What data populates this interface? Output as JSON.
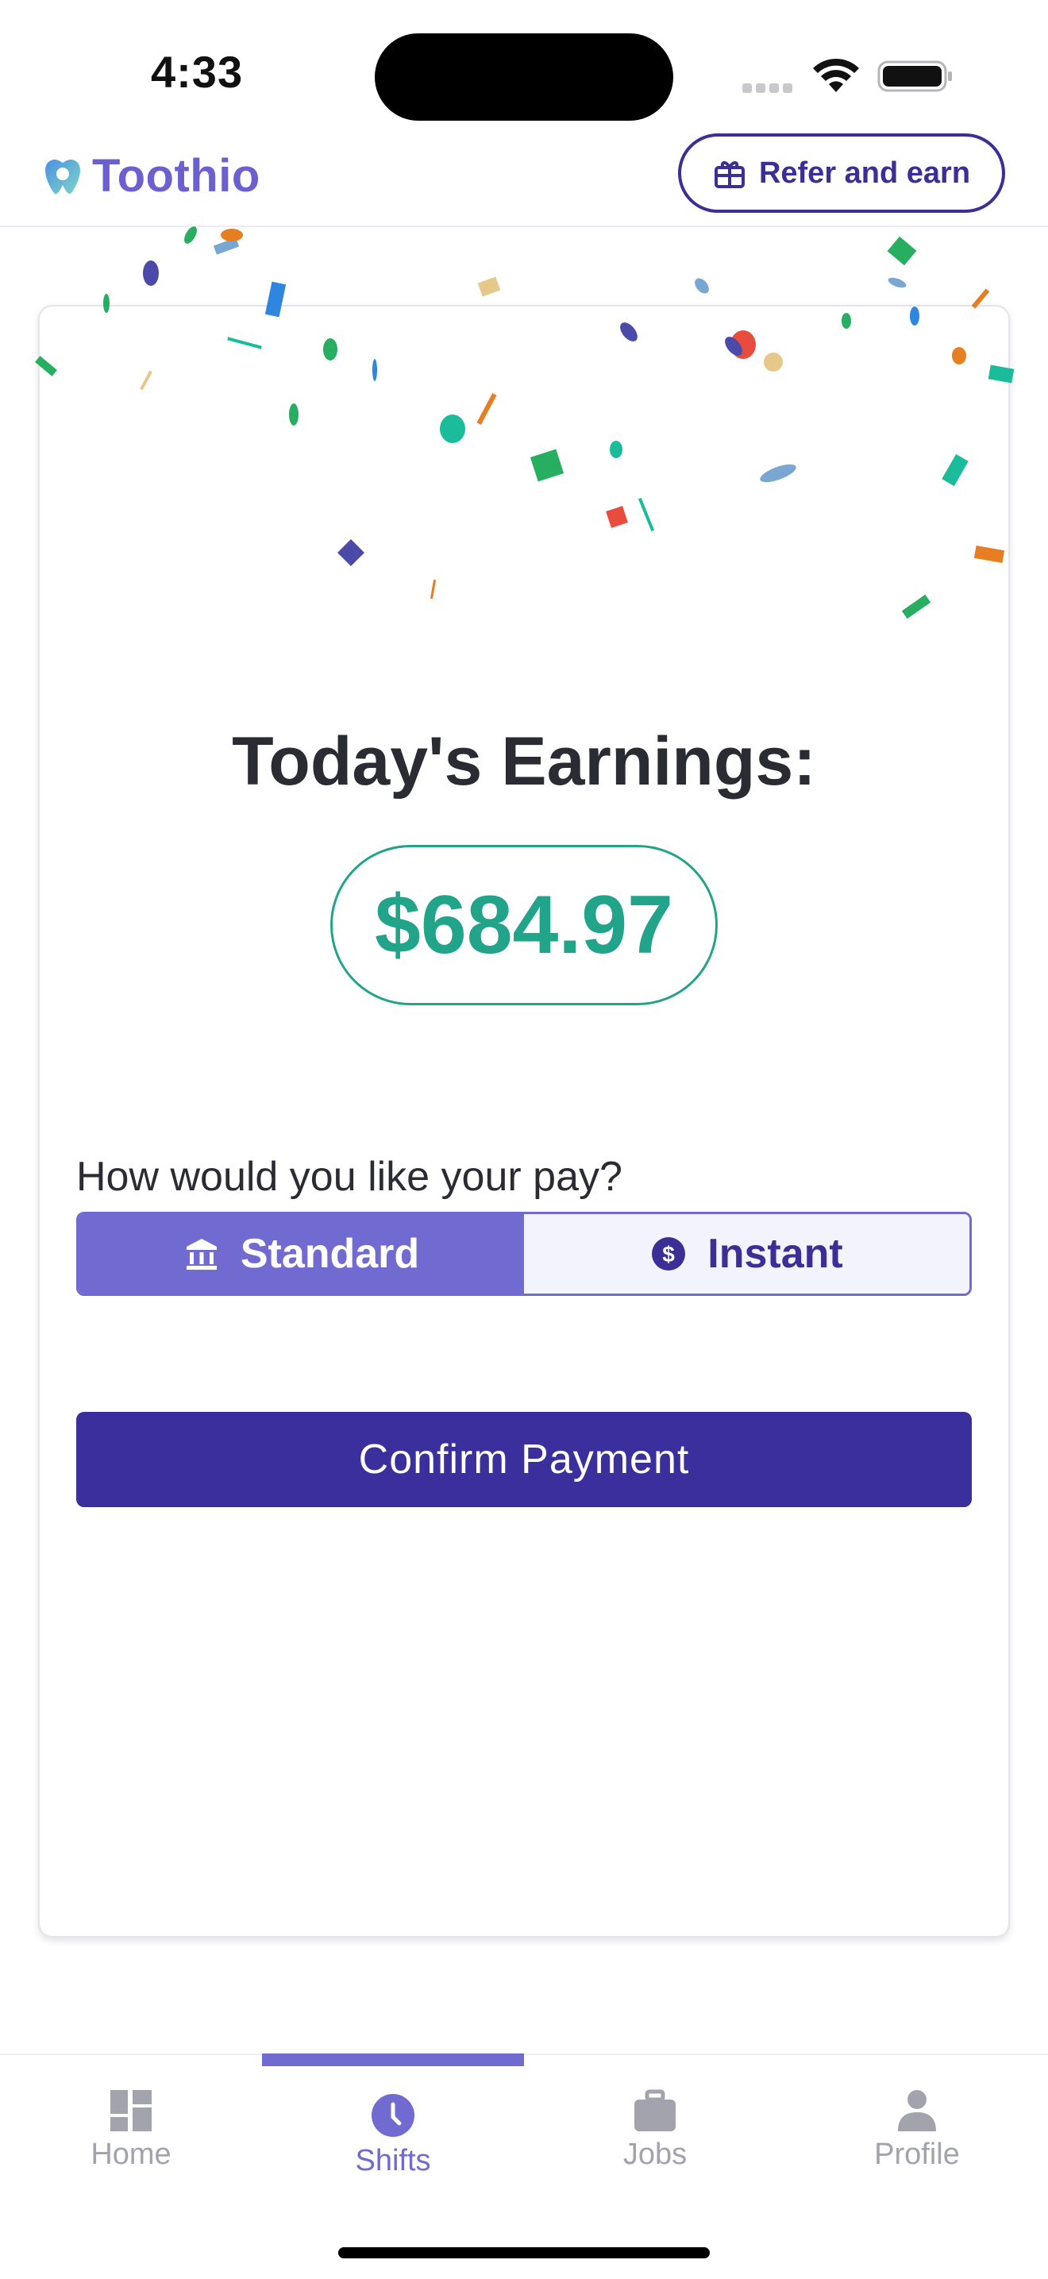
{
  "status_bar": {
    "time": "4:33"
  },
  "header": {
    "brand": "Toothio",
    "refer_label": "Refer and earn"
  },
  "earnings": {
    "title": "Today's Earnings:",
    "amount": "$684.97",
    "question": "How would you like your pay?",
    "options": [
      {
        "label": "Standard",
        "icon": "bank-icon",
        "selected": true
      },
      {
        "label": "Instant",
        "icon": "dollar-coin-icon",
        "selected": false
      }
    ],
    "confirm_label": "Confirm Payment"
  },
  "tabs": [
    {
      "label": "Home",
      "icon": "dashboard-icon",
      "active": false
    },
    {
      "label": "Shifts",
      "icon": "clock-icon",
      "active": true
    },
    {
      "label": "Jobs",
      "icon": "briefcase-icon",
      "active": false
    },
    {
      "label": "Profile",
      "icon": "person-icon",
      "active": false
    }
  ],
  "colors": {
    "brand": "#6c5fcf",
    "accent_dark": "#3b2f9e",
    "accent": "#716ad1",
    "money": "#21a489"
  }
}
